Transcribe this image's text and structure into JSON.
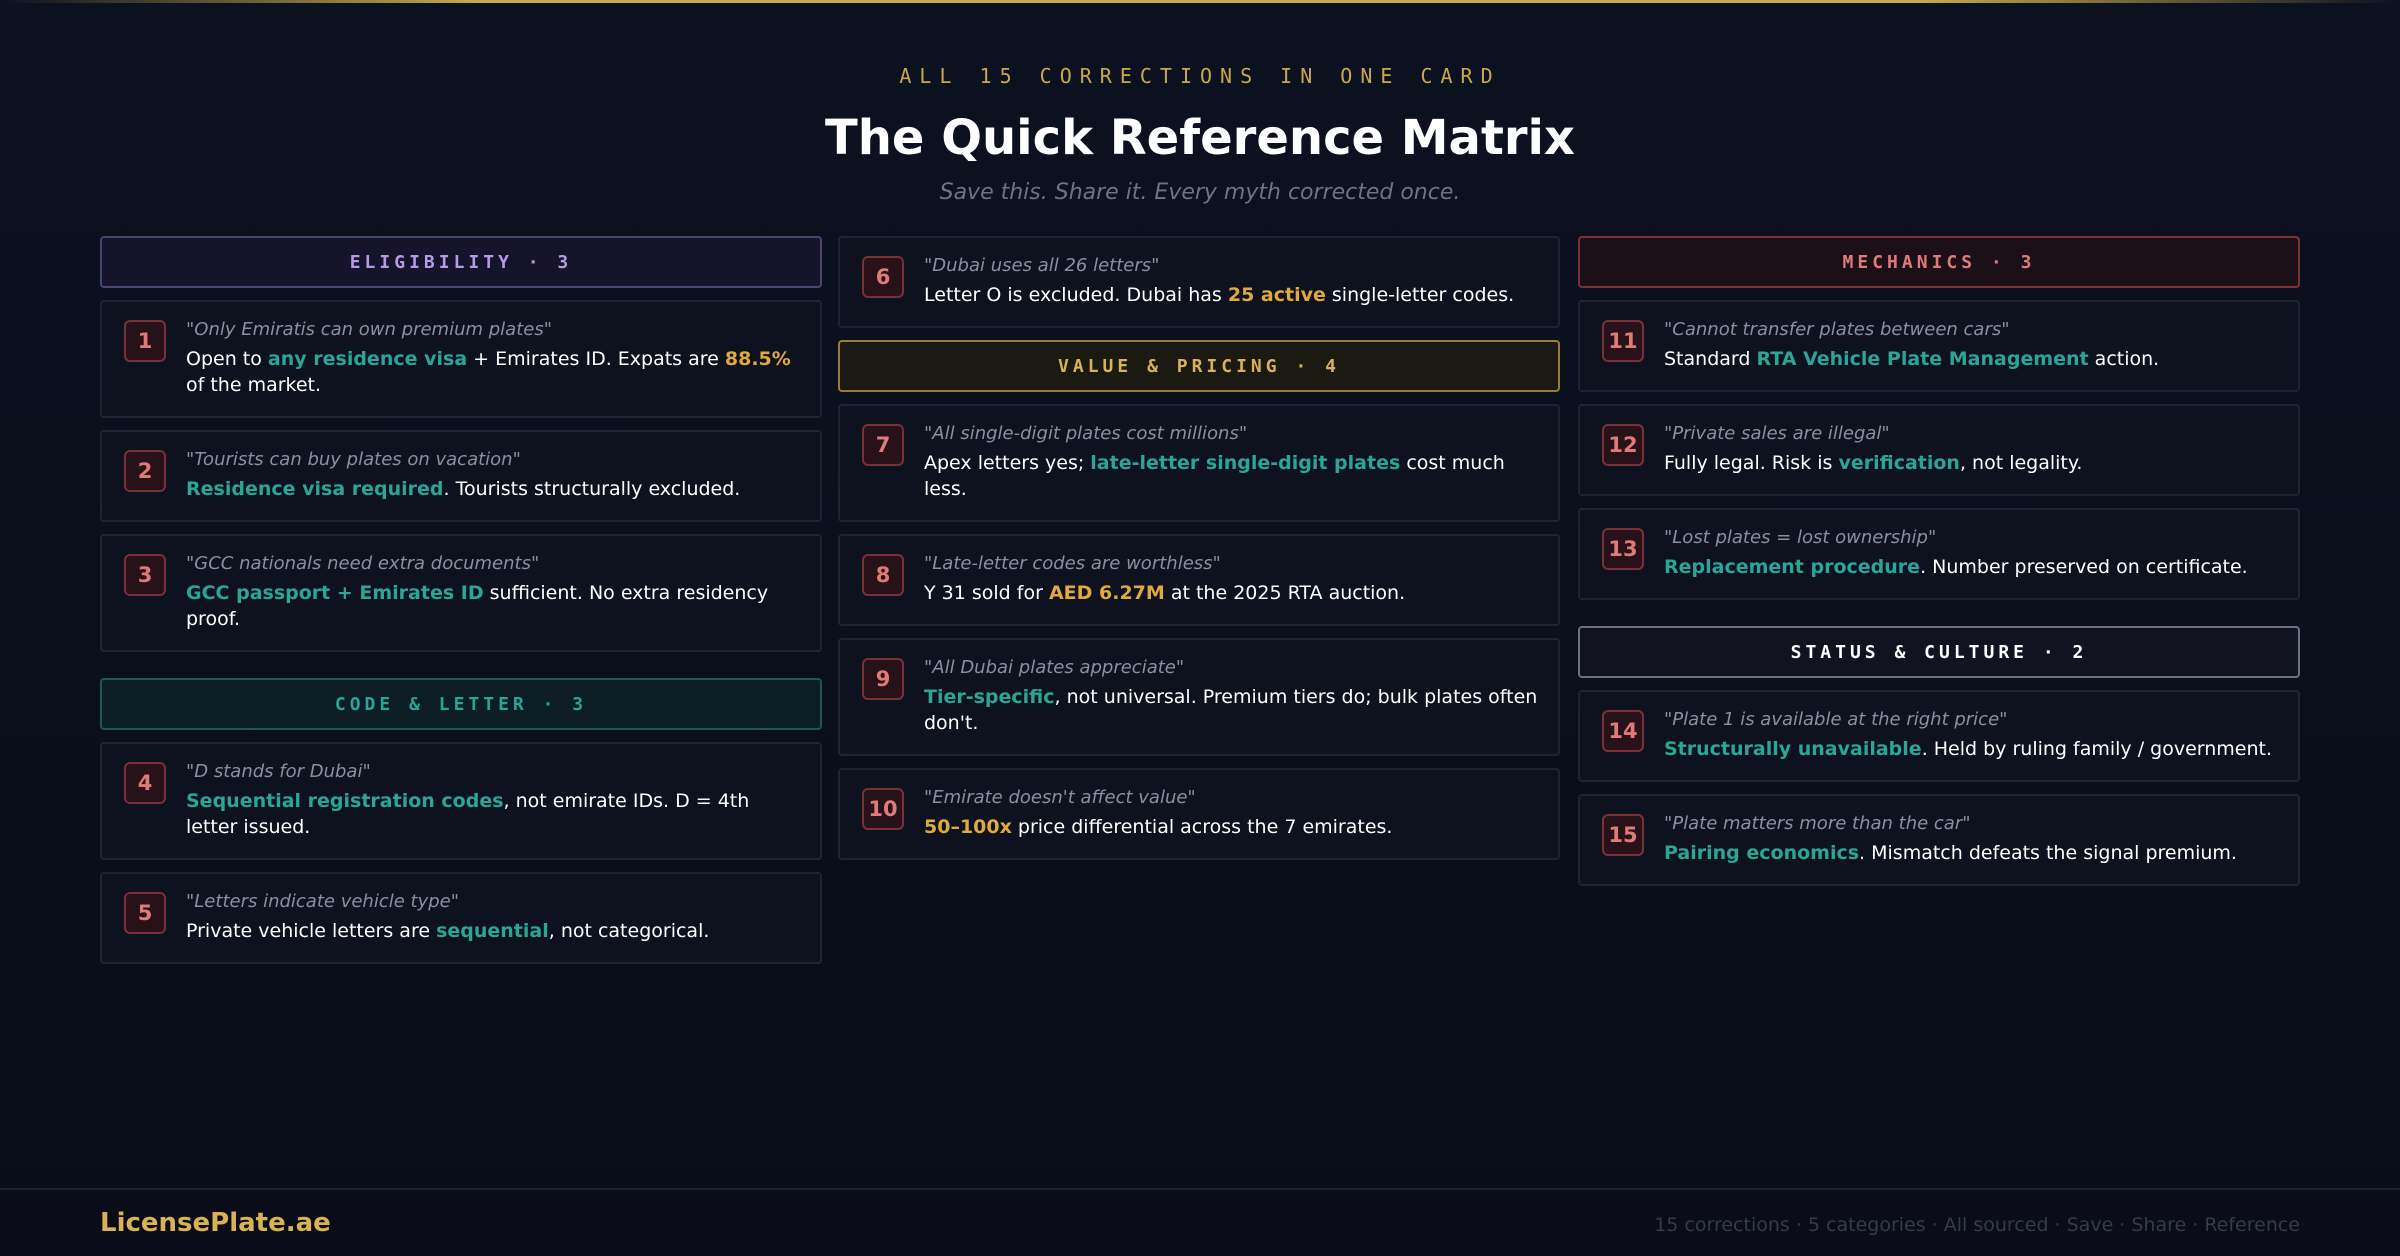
{
  "header": {
    "eyebrow": "ALL 15 CORRECTIONS IN ONE CARD",
    "title": "The Quick Reference Matrix",
    "subtitle": "Save this. Share it. Every myth corrected once."
  },
  "categories": {
    "eligibility": "ELIGIBILITY · 3",
    "code_letter": "CODE & LETTER · 3",
    "value_pricing": "VALUE & PRICING · 4",
    "mechanics": "MECHANICS · 3",
    "status_culture": "STATUS & CULTURE · 2"
  },
  "items": [
    {
      "num": "1",
      "myth": "\"Only Emiratis can own premium plates\"",
      "fact": [
        "Open to ",
        "any residence visa",
        " + Emirates ID. Expats are ",
        "88.5%",
        " of the market."
      ]
    },
    {
      "num": "2",
      "myth": "\"Tourists can buy plates on vacation\"",
      "fact": [
        "Residence visa required",
        ". Tourists structurally excluded."
      ]
    },
    {
      "num": "3",
      "myth": "\"GCC nationals need extra documents\"",
      "fact": [
        "GCC passport + Emirates ID",
        " sufficient. No extra residency proof."
      ]
    },
    {
      "num": "4",
      "myth": "\"D stands for Dubai\"",
      "fact": [
        "Sequential registration codes",
        ", not emirate IDs. D = 4th letter issued."
      ]
    },
    {
      "num": "5",
      "myth": "\"Letters indicate vehicle type\"",
      "fact": [
        "Private vehicle letters are ",
        "sequential",
        ", not categorical."
      ]
    },
    {
      "num": "6",
      "myth": "\"Dubai uses all 26 letters\"",
      "fact": [
        "Letter O is excluded. Dubai has ",
        "25 active",
        " single-letter codes."
      ]
    },
    {
      "num": "7",
      "myth": "\"All single-digit plates cost millions\"",
      "fact": [
        "Apex letters yes; ",
        "late-letter single-digit plates",
        " cost much less."
      ]
    },
    {
      "num": "8",
      "myth": "\"Late-letter codes are worthless\"",
      "fact": [
        "Y 31 sold for ",
        "AED 6.27M",
        " at the 2025 RTA auction."
      ]
    },
    {
      "num": "9",
      "myth": "\"All Dubai plates appreciate\"",
      "fact": [
        "Tier-specific",
        ", not universal. Premium tiers do; bulk plates often don't."
      ]
    },
    {
      "num": "10",
      "myth": "\"Emirate doesn't affect value\"",
      "fact": [
        "50–100x",
        " price differential across the 7 emirates."
      ]
    },
    {
      "num": "11",
      "myth": "\"Cannot transfer plates between cars\"",
      "fact": [
        "Standard ",
        "RTA Vehicle Plate Management",
        " action."
      ]
    },
    {
      "num": "12",
      "myth": "\"Private sales are illegal\"",
      "fact": [
        "Fully legal. Risk is ",
        "verification",
        ", not legality."
      ]
    },
    {
      "num": "13",
      "myth": "\"Lost plates = lost ownership\"",
      "fact": [
        "Replacement procedure",
        ". Number preserved on certificate."
      ]
    },
    {
      "num": "14",
      "myth": "\"Plate 1 is available at the right price\"",
      "fact": [
        "Structurally unavailable",
        ". Held by ruling family / government."
      ]
    },
    {
      "num": "15",
      "myth": "\"Plate matters more than the car\"",
      "fact": [
        "Pairing economics",
        ". Mismatch defeats the signal premium."
      ]
    }
  ],
  "footer": {
    "brand": "LicensePlate.ae",
    "tagline": "15 corrections · 5 categories · All sourced · Save · Share · Reference"
  },
  "colors": {
    "accent_gold": "#c9a84c",
    "highlight_teal": "#2aa596",
    "highlight_gold": "#e0a83e",
    "number_red": "#e07a78",
    "background": "#0b0f1b"
  }
}
